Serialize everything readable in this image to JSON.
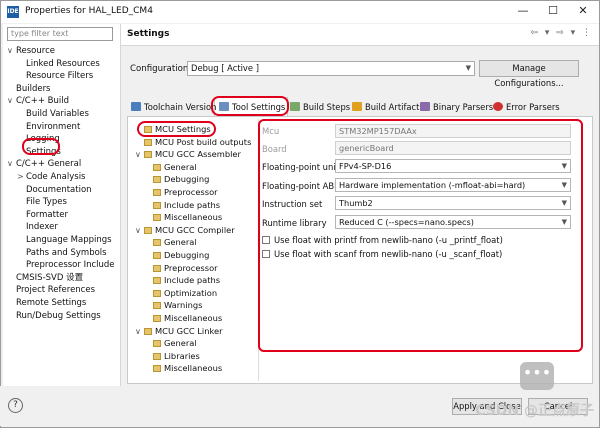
{
  "window": {
    "title": "Properties for HAL_LED_CM4",
    "app_icon": "IDE",
    "minimize": "—",
    "maximize": "☐",
    "close": "✕"
  },
  "left_tree": {
    "filter_placeholder": "type filter text",
    "items": [
      {
        "label": "Resource",
        "chevron": "∨",
        "level": 0
      },
      {
        "label": "Linked Resources",
        "level": 1
      },
      {
        "label": "Resource Filters",
        "level": 1
      },
      {
        "label": "Builders",
        "level": 0
      },
      {
        "label": "C/C++ Build",
        "chevron": "∨",
        "level": 0
      },
      {
        "label": "Build Variables",
        "level": 1
      },
      {
        "label": "Environment",
        "level": 1
      },
      {
        "label": "Logging",
        "level": 1
      },
      {
        "label": "Settings",
        "level": 1,
        "selected": true
      },
      {
        "label": "C/C++ General",
        "chevron": "∨",
        "level": 0
      },
      {
        "label": "Code Analysis",
        "chevron": ">",
        "level": 1
      },
      {
        "label": "Documentation",
        "level": 1
      },
      {
        "label": "File Types",
        "level": 1
      },
      {
        "label": "Formatter",
        "level": 1
      },
      {
        "label": "Indexer",
        "level": 1
      },
      {
        "label": "Language Mappings",
        "level": 1
      },
      {
        "label": "Paths and Symbols",
        "level": 1
      },
      {
        "label": "Preprocessor Include",
        "level": 1
      },
      {
        "label": "CMSIS-SVD 设置",
        "level": 0
      },
      {
        "label": "Project References",
        "level": 0
      },
      {
        "label": "Remote Settings",
        "level": 0
      },
      {
        "label": "Run/Debug Settings",
        "level": 0
      }
    ]
  },
  "header": {
    "title": "Settings",
    "nav": "⇦ ▾ ⇨ ▾ ⋮"
  },
  "configuration": {
    "label": "Configuration:",
    "value": "Debug  [ Active ]",
    "manage_label": "Manage Configurations..."
  },
  "tabs": [
    {
      "label": "Toolchain Version",
      "icon_color": "#4a7fbf"
    },
    {
      "label": "Tool Settings",
      "icon_color": "#6a8fc0",
      "active": true
    },
    {
      "label": "Build Steps",
      "icon_color": "#7aa86a"
    },
    {
      "label": "Build Artifact",
      "icon_color": "#e0a020"
    },
    {
      "label": "Binary Parsers",
      "icon_color": "#8a6aa8"
    },
    {
      "label": "Error Parsers",
      "icon_color": "#d03030"
    }
  ],
  "tool_tree": [
    {
      "label": "MCU Settings",
      "level": 0,
      "selected": true
    },
    {
      "label": "MCU Post build outputs",
      "level": 0
    },
    {
      "label": "MCU GCC Assembler",
      "level": 0,
      "chevron": "∨"
    },
    {
      "label": "General",
      "level": 1
    },
    {
      "label": "Debugging",
      "level": 1
    },
    {
      "label": "Preprocessor",
      "level": 1
    },
    {
      "label": "Include paths",
      "level": 1
    },
    {
      "label": "Miscellaneous",
      "level": 1
    },
    {
      "label": "MCU GCC Compiler",
      "level": 0,
      "chevron": "∨"
    },
    {
      "label": "General",
      "level": 1
    },
    {
      "label": "Debugging",
      "level": 1
    },
    {
      "label": "Preprocessor",
      "level": 1
    },
    {
      "label": "Include paths",
      "level": 1
    },
    {
      "label": "Optimization",
      "level": 1
    },
    {
      "label": "Warnings",
      "level": 1
    },
    {
      "label": "Miscellaneous",
      "level": 1
    },
    {
      "label": "MCU GCC Linker",
      "level": 0,
      "chevron": "∨"
    },
    {
      "label": "General",
      "level": 1
    },
    {
      "label": "Libraries",
      "level": 1
    },
    {
      "label": "Miscellaneous",
      "level": 1
    }
  ],
  "mcu_settings": {
    "mcu": {
      "label": "Mcu",
      "value": "STM32MP157DAAx"
    },
    "board": {
      "label": "Board",
      "value": "genericBoard"
    },
    "fpu": {
      "label": "Floating-point unit",
      "value": "FPv4-SP-D16"
    },
    "fabi": {
      "label": "Floating-point ABI",
      "value": "Hardware implementation (-mfloat-abi=hard)"
    },
    "iset": {
      "label": "Instruction set",
      "value": "Thumb2"
    },
    "runtime": {
      "label": "Runtime library",
      "value": "Reduced C (--specs=nano.specs)"
    },
    "printf_float": "Use float with printf from newlib-nano (-u _printf_float)",
    "scanf_float": "Use float with scanf from newlib-nano (-u _scanf_float)"
  },
  "footer": {
    "help": "?",
    "apply_close": "Apply and Close",
    "cancel": "Cancel",
    "watermark": "CSDN @正点原子"
  },
  "chat_icon": "•••"
}
